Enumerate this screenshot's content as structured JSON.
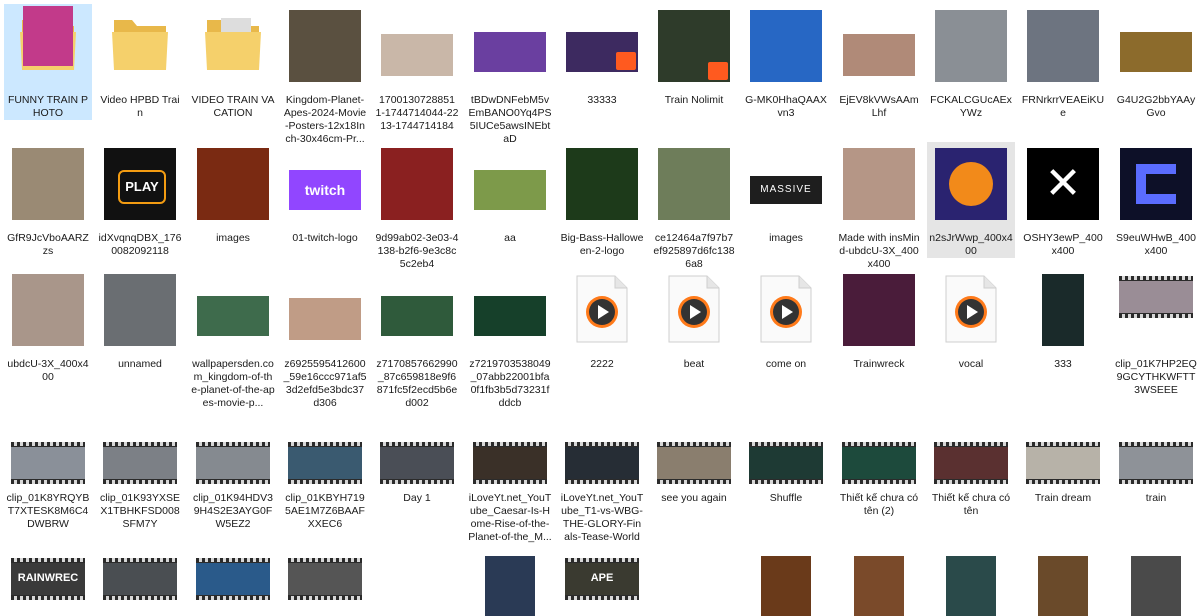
{
  "items": [
    {
      "label": "FUNNY TRAIN PHOTO",
      "kind": "folder-photo",
      "state": "selected",
      "color": "#2c3a8a"
    },
    {
      "label": "Video HPBD Train",
      "kind": "folder",
      "color": "#f5d06b"
    },
    {
      "label": "VIDEO TRAIN VACATION",
      "kind": "folder-video",
      "color": "#f5d06b"
    },
    {
      "label": "Kingdom-Planet-Apes-2024-Movie-Posters-12x18Inch-30x46cm-Pr...",
      "kind": "poster",
      "color": "#5a5040"
    },
    {
      "label": "1700130728851 1-1744714044-2213-1744714184",
      "kind": "photo",
      "color": "#c9b7a8"
    },
    {
      "label": "tBDwDNFebM5vEmBANO0Yq4PS5IUCe5awsINEbtaD",
      "kind": "banner",
      "color": "#6a3fa0"
    },
    {
      "label": "33333",
      "kind": "banner-badge",
      "color": "#3d2a60"
    },
    {
      "label": "Train Nolimit",
      "kind": "poster-badge",
      "color": "#2e3b2a"
    },
    {
      "label": "G-MK0HhaQAAXvn3",
      "kind": "poster",
      "color": "#2767c4"
    },
    {
      "label": "EjEV8kVWsAAmLhf",
      "kind": "photo",
      "color": "#b08a78"
    },
    {
      "label": "FCKALCGUcAExYWz",
      "kind": "poster",
      "color": "#8a8f95"
    },
    {
      "label": "FRNrkrrVEAEiKUe",
      "kind": "poster",
      "color": "#6d7480"
    },
    {
      "label": "G4U2G2bbYAAyGvo",
      "kind": "banner",
      "color": "#8c6b2c"
    },
    {
      "label": "GfR9JcVboAARZzs",
      "kind": "poster",
      "color": "#9a8a74"
    },
    {
      "label": "idXvqnqDBX_1760082092118",
      "kind": "play-logo",
      "color": "#111111"
    },
    {
      "label": "images",
      "kind": "square",
      "color": "#7a2a12"
    },
    {
      "label": "01-twitch-logo",
      "kind": "twitch",
      "color": "#9146ff"
    },
    {
      "label": "9d99ab02-3e03-4138-b2f6-9e3c8c5c2eb4",
      "kind": "square",
      "color": "#8a2020"
    },
    {
      "label": "aa",
      "kind": "banner",
      "color": "#7d9a4a"
    },
    {
      "label": "Big-Bass-Halloween-2-logo",
      "kind": "square",
      "color": "#1d3a1a"
    },
    {
      "label": "ce12464a7f97b7ef925897d6fc1386a8",
      "kind": "square",
      "color": "#6e7d5a"
    },
    {
      "label": "images",
      "kind": "massive",
      "color": "#1e1e1e",
      "text": "MASSIVE"
    },
    {
      "label": "Made with insMind-ubdcU-3X_400x400",
      "kind": "photo-sq",
      "color": "#b59686"
    },
    {
      "label": "n2sJrWwp_400x400",
      "kind": "pumpkin",
      "state": "hovered",
      "color": "#2a2370"
    },
    {
      "label": "OSHY3ewP_400x400",
      "kind": "x-logo",
      "color": "#000000"
    },
    {
      "label": "S9euWHwB_400x400",
      "kind": "c-logo",
      "color": "#0d1028"
    },
    {
      "label": "ubdcU-3X_400x400",
      "kind": "photo-sq",
      "color": "#a9968a"
    },
    {
      "label": "unnamed",
      "kind": "poster",
      "color": "#6a6e72"
    },
    {
      "label": "wallpapersden.com_kingdom-of-the-planet-of-the-apes-movie-p...",
      "kind": "banner",
      "color": "#3e6b4c"
    },
    {
      "label": "z6925595412600_59e16ccc971af53d2efd5e3bdc37d306",
      "kind": "photo",
      "color": "#c09c86"
    },
    {
      "label": "z7170857662990_87c659818e9f6871fc5f2ecd5b6ed002",
      "kind": "banner",
      "color": "#2f5a3b"
    },
    {
      "label": "z7219703538049_07abb22001bfa0f1fb3b5d73231fddcb",
      "kind": "banner",
      "color": "#16402a"
    },
    {
      "label": "2222",
      "kind": "audio"
    },
    {
      "label": "beat",
      "kind": "audio"
    },
    {
      "label": "come on",
      "kind": "audio"
    },
    {
      "label": "Trainwreck",
      "kind": "square",
      "color": "#4a1c3a"
    },
    {
      "label": "vocal",
      "kind": "audio"
    },
    {
      "label": "333",
      "kind": "poster-small",
      "color": "#1a2a2a"
    },
    {
      "label": "clip_01K7HP2EQ9GCYTHKWFTT3WSEEE",
      "kind": "film",
      "color": "#9a8d96"
    },
    {
      "label": "clip_01K8YRQYBT7XTESK8M6C4DWBRW",
      "kind": "film",
      "color": "#8a9099"
    },
    {
      "label": "clip_01K93YXSEX1TBHKFSD008SFM7Y",
      "kind": "film",
      "color": "#7c8086"
    },
    {
      "label": "clip_01K94HDV39H4S2E3AYG0FW5EZ2",
      "kind": "film",
      "color": "#858a90"
    },
    {
      "label": "clip_01KBYH7195AE1M7Z6BAAFXXEC6",
      "kind": "film",
      "color": "#3a5a70"
    },
    {
      "label": "Day 1",
      "kind": "film",
      "color": "#4a4e56"
    },
    {
      "label": "iLoveYt.net_YouTube_Caesar-Is-Home-Rise-of-the-Planet-of-the_M...",
      "kind": "film",
      "color": "#3a3028"
    },
    {
      "label": "iLoveYt.net_YouTube_T1-vs-WBG-THE-GLORY-Finals-Tease-Worlds...",
      "kind": "film",
      "color": "#262d35"
    },
    {
      "label": "see you again",
      "kind": "film",
      "color": "#8a7e6e"
    },
    {
      "label": "Shuffle",
      "kind": "film",
      "color": "#1e3a34"
    },
    {
      "label": "Thiết kế chưa có tên (2)",
      "kind": "film",
      "color": "#1d4a3c"
    },
    {
      "label": "Thiết kế chưa có tên",
      "kind": "film",
      "color": "#5a3030"
    },
    {
      "label": "Train dream",
      "kind": "film",
      "color": "#b7b2a8"
    },
    {
      "label": "train",
      "kind": "film",
      "color": "#8e9298"
    },
    {
      "label": "",
      "kind": "film-partial",
      "color": "#3a3a3a",
      "text": "RAINWREC"
    },
    {
      "label": "",
      "kind": "film-partial",
      "color": "#4a4e52"
    },
    {
      "label": "",
      "kind": "film-partial",
      "color": "#2a5a8a"
    },
    {
      "label": "",
      "kind": "film-partial",
      "color": "#555555"
    },
    {
      "label": "",
      "kind": "none"
    },
    {
      "label": "",
      "kind": "poster-partial",
      "color": "#2a3a55"
    },
    {
      "label": "",
      "kind": "film-partial",
      "color": "#3a3a30",
      "text": "APE"
    },
    {
      "label": "",
      "kind": "none"
    },
    {
      "label": "",
      "kind": "poster-partial",
      "color": "#6a3a1a"
    },
    {
      "label": "",
      "kind": "poster-partial",
      "color": "#7a4a2a"
    },
    {
      "label": "",
      "kind": "poster-partial",
      "color": "#2a4a4a"
    },
    {
      "label": "",
      "kind": "poster-partial",
      "color": "#6a4a2a"
    },
    {
      "label": "",
      "kind": "poster-partial",
      "color": "#4a4a4a"
    },
    {
      "label": "",
      "kind": "poster-partial",
      "color": "#c23a8a"
    }
  ]
}
